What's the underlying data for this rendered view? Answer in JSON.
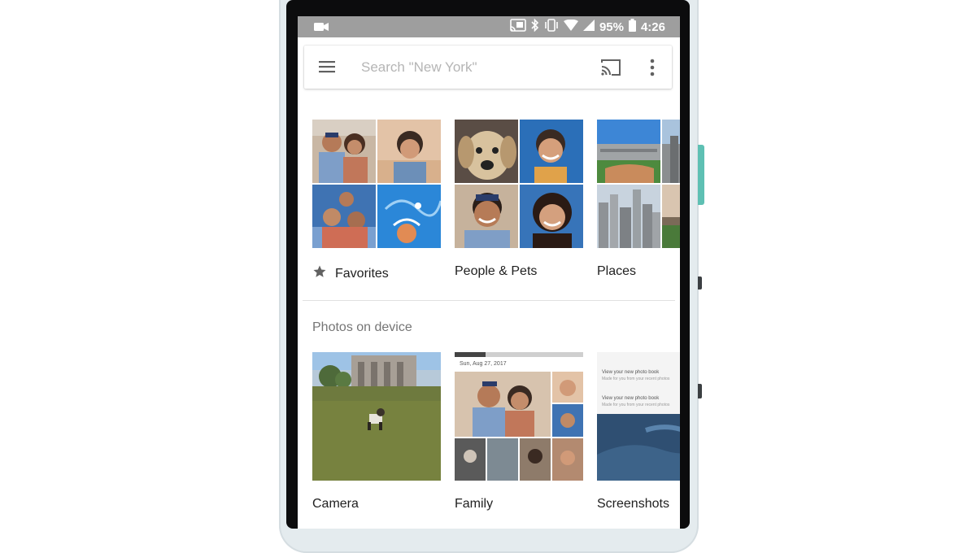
{
  "status_bar": {
    "battery": "95%",
    "time": "4:26"
  },
  "search": {
    "placeholder": "Search \"New York\""
  },
  "top_albums": [
    {
      "label": "Favorites",
      "icon": "star-icon"
    },
    {
      "label": "People & Pets"
    },
    {
      "label": "Places"
    }
  ],
  "section": {
    "title": "Photos on device"
  },
  "device_albums": [
    {
      "label": "Camera"
    },
    {
      "label": "Family"
    },
    {
      "label": "Screenshots"
    }
  ],
  "family_album_date": "Sun, Aug 27, 2017",
  "screenshot_notifications": [
    {
      "title": "View your new photo book",
      "body": "Made for you from your recent photos"
    },
    {
      "title": "View your new photo book",
      "body": "Made for you from your recent photos"
    }
  ],
  "colors": {
    "status_bar": "#9e9e9e",
    "bezel": "#0c0c0d",
    "phone_frame": "#e4ebee",
    "side_button": "#5ec0b3"
  }
}
